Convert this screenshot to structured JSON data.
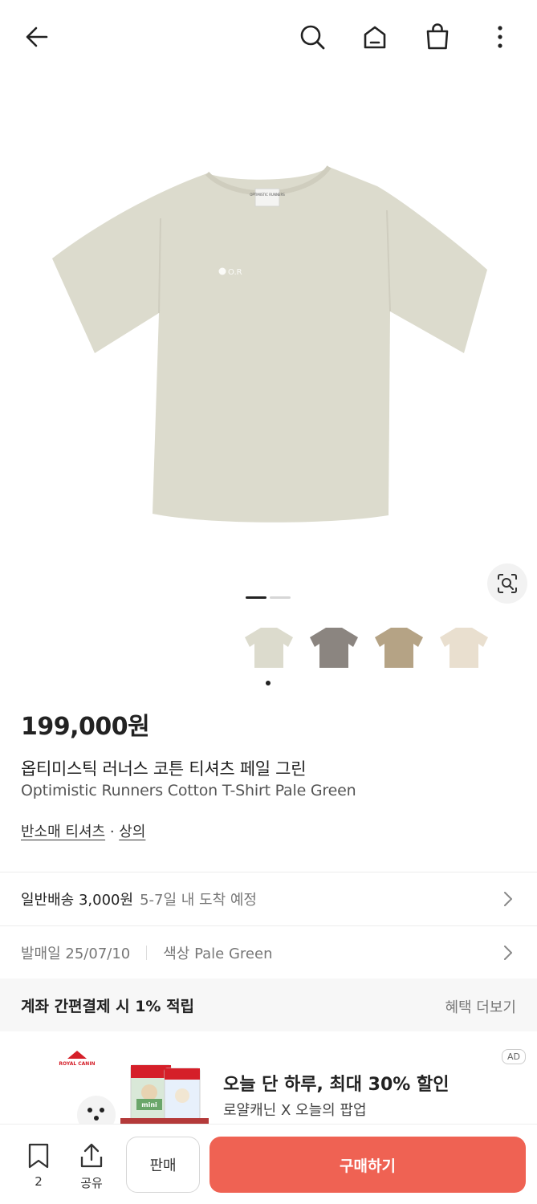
{
  "header": {
    "back_icon": "arrow-left-icon",
    "search_icon": "search-icon",
    "home_icon": "home-icon",
    "cart_icon": "shopping-bag-icon",
    "more_icon": "more-vertical-icon"
  },
  "gallery": {
    "image_index": 1,
    "image_count": 2,
    "lens_icon": "lens-search-icon",
    "print_text": "O.R",
    "tag_text": "OPTIMISTIC RUNNERS"
  },
  "swatches": [
    {
      "name": "Pale Green",
      "color": "#dcdbcd"
    },
    {
      "name": "Grey",
      "color": "#8b8580"
    },
    {
      "name": "Khaki",
      "color": "#b5a385"
    },
    {
      "name": "Cream",
      "color": "#e9dfcf"
    }
  ],
  "product": {
    "price": "199,000원",
    "name_ko": "옵티미스틱 러너스 코튼 티셔츠 페일 그린",
    "name_en": "Optimistic Runners Cotton T-Shirt Pale Green",
    "category_1": "반소매 티셔츠",
    "category_sep": " · ",
    "category_2": "상의"
  },
  "shipping": {
    "label": "일반배송 3,000원",
    "eta": "5-7일 내 도착 예정"
  },
  "release": {
    "label": "발매일 25/07/10",
    "color_label": "색상 Pale Green"
  },
  "benefit": {
    "title": "계좌 간편결제 시 1% 적립",
    "more": "혜택 더보기"
  },
  "ad": {
    "badge": "AD",
    "title": "오늘 단 하루, 최대 30% 할인",
    "subtitle": "로얄캐닌 X 오늘의 팝업",
    "brand": "ROYAL CANIN",
    "pack_label": "mini"
  },
  "bottom_bar": {
    "bookmark_count": "2",
    "share_label": "공유",
    "sell_label": "판매",
    "buy_label": "구매하기"
  },
  "colors": {
    "accent": "#ef6253",
    "shirt": "#dcdbcd"
  }
}
